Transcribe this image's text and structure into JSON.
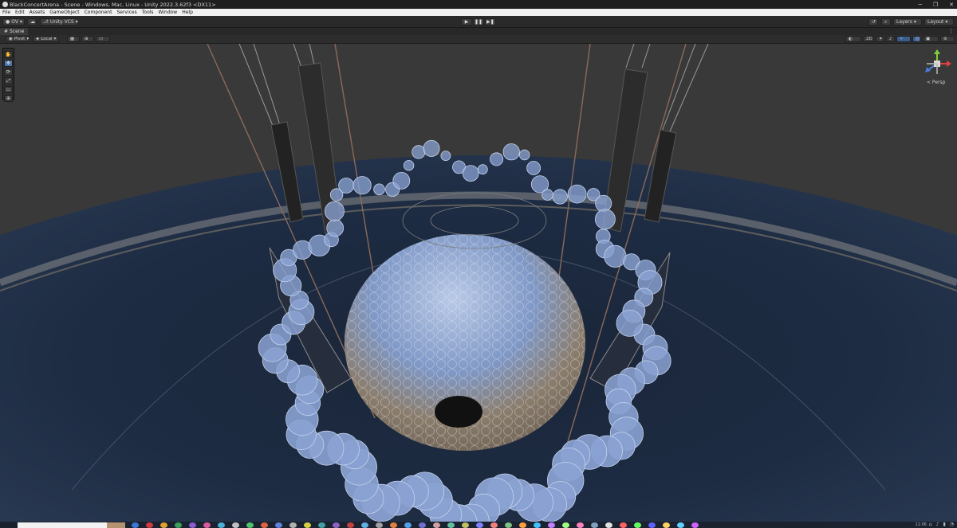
{
  "window": {
    "title": "BlackConcertArena - Scene - Windows, Mac, Linux - Unity 2022.3.62f3 <DX11>",
    "minimize_icon": "minimize-icon",
    "restore_icon": "restore-icon",
    "close_icon": "close-icon",
    "minimize": "─",
    "restore": "❐",
    "close": "✕"
  },
  "menu": [
    "File",
    "Edit",
    "Assets",
    "GameObject",
    "Component",
    "Services",
    "Tools",
    "Window",
    "Help"
  ],
  "toolbar": {
    "account_label": "OV",
    "vcs_label": "Unity VCS",
    "play_symbol": "▶",
    "pause_symbol": "❚❚",
    "step_symbol": "▶❚",
    "layers_label": "Layers",
    "layout_label": "Layout"
  },
  "scene_tab": {
    "label": "Scene",
    "more_symbol": "⋮"
  },
  "scene_bar": {
    "pivot_label": "Pivot",
    "local_label": "Local",
    "mode_2d_label": "2D"
  },
  "tool_icons": [
    "hand-tool-icon",
    "move-tool-icon",
    "rotate-tool-icon",
    "scale-tool-icon",
    "rect-tool-icon",
    "transform-tool-icon"
  ],
  "tool_symbols": [
    "✋",
    "✥",
    "⟳",
    "⤢",
    "▭",
    "⊕"
  ],
  "viewport": {
    "projection_label": "< Persp",
    "gizmo_axes": [
      "x",
      "y",
      "z"
    ]
  },
  "taskbar": {
    "time": "11:06",
    "date_hint": "",
    "icon_colors": [
      "#3a78d8",
      "#d03a3a",
      "#e0a030",
      "#3aa05a",
      "#8a5ad0",
      "#d85a9a",
      "#4ab0d8",
      "#c0c0c0",
      "#50c070",
      "#e06040",
      "#6080e0",
      "#b0b0b0",
      "#d0d040",
      "#40a0a0",
      "#9060c0",
      "#c04040",
      "#60b0e0",
      "#a0a0a0",
      "#e08040",
      "#50a0f0",
      "#7070d0",
      "#d0a0a0",
      "#60c0a0",
      "#c0c060",
      "#8080ff",
      "#f08080",
      "#80c080",
      "#ffa040",
      "#40c0ff",
      "#c080ff",
      "#a0ff80",
      "#ff80c0",
      "#80a0c0",
      "#e0e0e0",
      "#ff6060",
      "#60ff60",
      "#6060ff",
      "#ffd060",
      "#60d0ff",
      "#d060ff"
    ],
    "tray_icons": [
      "network-icon",
      "sound-icon",
      "battery-icon",
      "notification-icon"
    ],
    "tray_symbols": [
      "⌂",
      "♪",
      "▮",
      "◔"
    ]
  },
  "colors": {
    "sky": "#3a3a3a",
    "water": "#1b2a40",
    "sphere_blue": "#7f98c6",
    "sphere_tan": "#8b7d6c",
    "disc_blue": "#8aa2d2"
  }
}
